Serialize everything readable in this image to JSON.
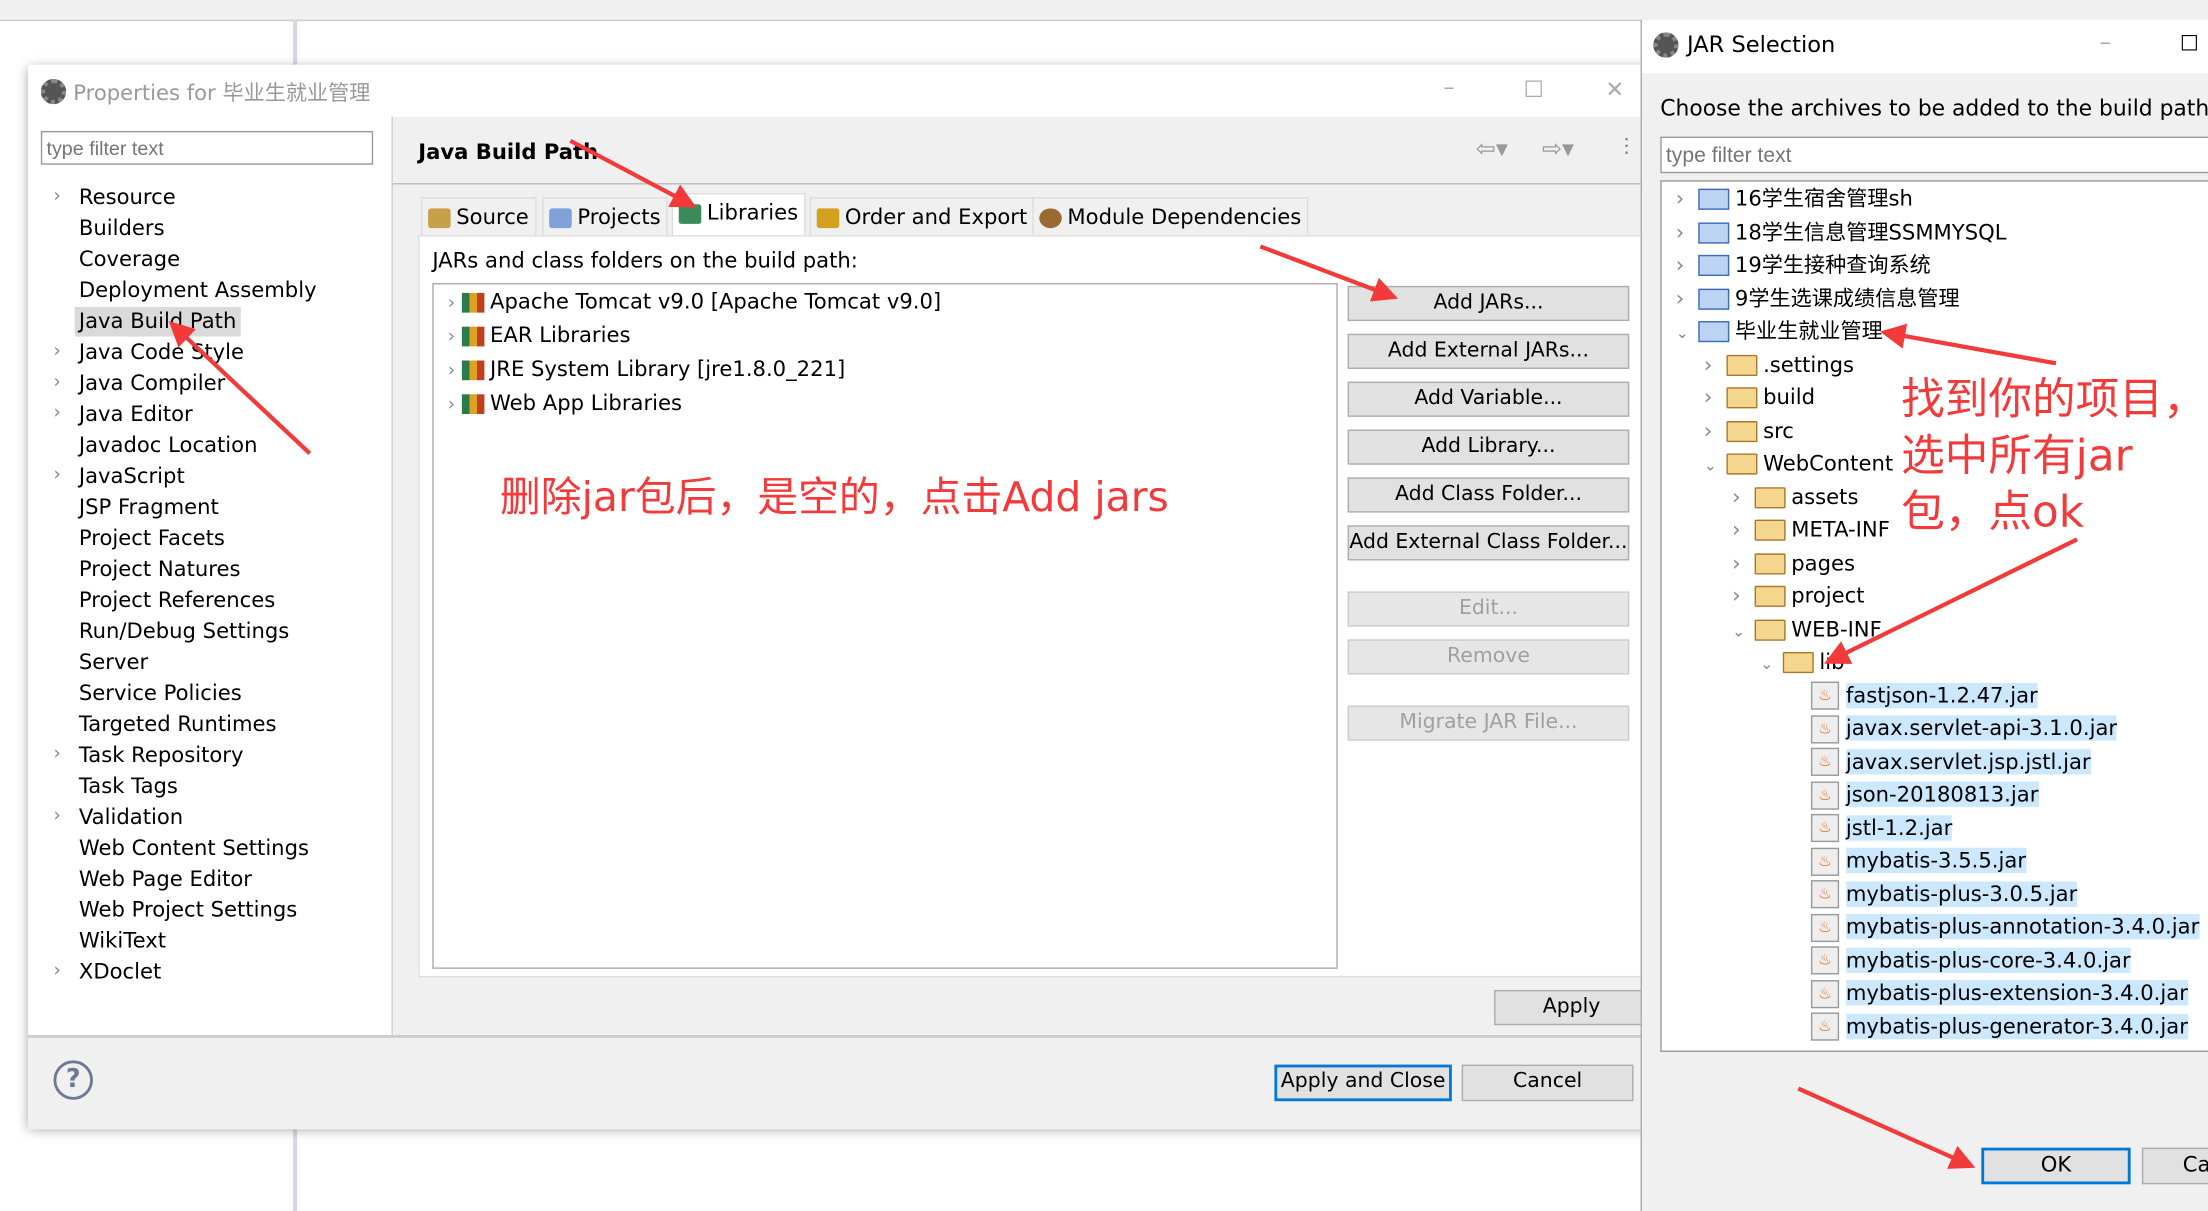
{
  "properties_dialog": {
    "title": "Properties for 毕业生就业管理",
    "filter_placeholder": "type filter text",
    "nav_items": [
      {
        "label": "Resource",
        "expandable": true
      },
      {
        "label": "Builders",
        "expandable": false
      },
      {
        "label": "Coverage",
        "expandable": false
      },
      {
        "label": "Deployment Assembly",
        "expandable": false
      },
      {
        "label": "Java Build Path",
        "expandable": false,
        "selected": true
      },
      {
        "label": "Java Code Style",
        "expandable": true
      },
      {
        "label": "Java Compiler",
        "expandable": true
      },
      {
        "label": "Java Editor",
        "expandable": true
      },
      {
        "label": "Javadoc Location",
        "expandable": false
      },
      {
        "label": "JavaScript",
        "expandable": true
      },
      {
        "label": "JSP Fragment",
        "expandable": false
      },
      {
        "label": "Project Facets",
        "expandable": false
      },
      {
        "label": "Project Natures",
        "expandable": false
      },
      {
        "label": "Project References",
        "expandable": false
      },
      {
        "label": "Run/Debug Settings",
        "expandable": false
      },
      {
        "label": "Server",
        "expandable": false
      },
      {
        "label": "Service Policies",
        "expandable": false
      },
      {
        "label": "Targeted Runtimes",
        "expandable": false
      },
      {
        "label": "Task Repository",
        "expandable": true
      },
      {
        "label": "Task Tags",
        "expandable": false
      },
      {
        "label": "Validation",
        "expandable": true
      },
      {
        "label": "Web Content Settings",
        "expandable": false
      },
      {
        "label": "Web Page Editor",
        "expandable": false
      },
      {
        "label": "Web Project Settings",
        "expandable": false
      },
      {
        "label": "WikiText",
        "expandable": false
      },
      {
        "label": "XDoclet",
        "expandable": true
      }
    ],
    "page_title": "Java Build Path",
    "tabs": [
      {
        "label": "Source"
      },
      {
        "label": "Projects"
      },
      {
        "label": "Libraries",
        "active": true
      },
      {
        "label": "Order and Export"
      },
      {
        "label": "Module Dependencies"
      }
    ],
    "list_label": "JARs and class folders on the build path:",
    "libraries": [
      "Apache Tomcat v9.0 [Apache Tomcat v9.0]",
      "EAR Libraries",
      "JRE System Library [jre1.8.0_221]",
      "Web App Libraries"
    ],
    "buttons": [
      {
        "label": "Add JARs...",
        "enabled": true
      },
      {
        "label": "Add External JARs...",
        "enabled": true
      },
      {
        "label": "Add Variable...",
        "enabled": true
      },
      {
        "label": "Add Library...",
        "enabled": true
      },
      {
        "label": "Add Class Folder...",
        "enabled": true
      },
      {
        "label": "Add External Class Folder...",
        "enabled": true
      },
      {
        "label": "Edit...",
        "enabled": false
      },
      {
        "label": "Remove",
        "enabled": false
      },
      {
        "label": "Migrate JAR File...",
        "enabled": false
      }
    ],
    "apply": "Apply",
    "apply_close": "Apply and Close",
    "cancel": "Cancel",
    "help": "?"
  },
  "jar_dialog": {
    "title": "JAR Selection",
    "prompt": "Choose the archives to be added to the build path:",
    "filter_placeholder": "type filter text",
    "tree": [
      {
        "label": "16学生宿舍管理sh",
        "level": 0,
        "type": "project",
        "state": "collapsed"
      },
      {
        "label": "18学生信息管理SSMMYSQL",
        "level": 0,
        "type": "project",
        "state": "collapsed"
      },
      {
        "label": "19学生接种查询系统",
        "level": 0,
        "type": "project",
        "state": "collapsed"
      },
      {
        "label": "9学生选课成绩信息管理",
        "level": 0,
        "type": "project",
        "state": "collapsed"
      },
      {
        "label": "毕业生就业管理",
        "level": 0,
        "type": "project",
        "state": "expanded"
      },
      {
        "label": ".settings",
        "level": 1,
        "type": "folder",
        "state": "collapsed"
      },
      {
        "label": "build",
        "level": 1,
        "type": "folder",
        "state": "collapsed"
      },
      {
        "label": "src",
        "level": 1,
        "type": "folder",
        "state": "collapsed"
      },
      {
        "label": "WebContent",
        "level": 1,
        "type": "folder",
        "state": "expanded"
      },
      {
        "label": "assets",
        "level": 2,
        "type": "folder",
        "state": "collapsed"
      },
      {
        "label": "META-INF",
        "level": 2,
        "type": "folder",
        "state": "collapsed"
      },
      {
        "label": "pages",
        "level": 2,
        "type": "folder",
        "state": "collapsed"
      },
      {
        "label": "project",
        "level": 2,
        "type": "folder",
        "state": "collapsed"
      },
      {
        "label": "WEB-INF",
        "level": 2,
        "type": "folder",
        "state": "expanded"
      },
      {
        "label": "lib",
        "level": 3,
        "type": "folder",
        "state": "expanded"
      },
      {
        "label": "fastjson-1.2.47.jar",
        "level": 4,
        "type": "jar",
        "selected": true
      },
      {
        "label": "javax.servlet-api-3.1.0.jar",
        "level": 4,
        "type": "jar",
        "selected": true
      },
      {
        "label": "javax.servlet.jsp.jstl.jar",
        "level": 4,
        "type": "jar",
        "selected": true
      },
      {
        "label": "json-20180813.jar",
        "level": 4,
        "type": "jar",
        "selected": true
      },
      {
        "label": "jstl-1.2.jar",
        "level": 4,
        "type": "jar",
        "selected": true
      },
      {
        "label": "mybatis-3.5.5.jar",
        "level": 4,
        "type": "jar",
        "selected": true
      },
      {
        "label": "mybatis-plus-3.0.5.jar",
        "level": 4,
        "type": "jar",
        "selected": true
      },
      {
        "label": "mybatis-plus-annotation-3.4.0.jar",
        "level": 4,
        "type": "jar",
        "selected": true
      },
      {
        "label": "mybatis-plus-core-3.4.0.jar",
        "level": 4,
        "type": "jar",
        "selected": true
      },
      {
        "label": "mybatis-plus-extension-3.4.0.jar",
        "level": 4,
        "type": "jar",
        "selected": true
      },
      {
        "label": "mybatis-plus-generator-3.4.0.jar",
        "level": 4,
        "type": "jar",
        "selected": true
      }
    ],
    "ok": "OK",
    "cancel": "Ca"
  },
  "annotations": {
    "note1": "删除jar包后，是空的，点击Add jars",
    "note2_lines": [
      "找到你的项目，",
      "选中所有jar",
      "包，点ok"
    ],
    "color": "#f23a3a"
  },
  "colors": {
    "selection": "#cce8ff",
    "default_button_border": "#0078d7"
  }
}
